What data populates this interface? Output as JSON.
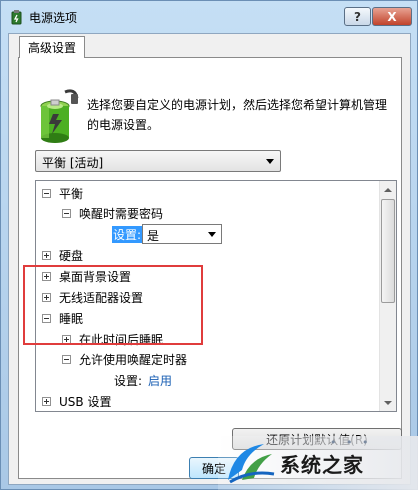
{
  "window": {
    "title": "电源选项",
    "help_label": "?",
    "close_label": "X"
  },
  "tab": {
    "label": "高级设置"
  },
  "description": "选择您要自定义的电源计划，然后选择您希望计算机管理的电源设置。",
  "plan_select": {
    "value": "平衡 [活动]"
  },
  "tree": {
    "balance": "平衡",
    "wake_password": "唤醒时需要密码",
    "setting_label": "设置:",
    "setting_value": "是",
    "hard_disk": "硬盘",
    "desktop_bg": "桌面背景设置",
    "wireless": "无线适配器设置",
    "sleep": "睡眠",
    "sleep_after": "在此时间后睡眠",
    "wake_timers": "允许使用唤醒定时器",
    "wake_setting_label": "设置:",
    "wake_setting_value": "启用",
    "usb": "USB 设置"
  },
  "buttons": {
    "restore": "还原计划默认值(R)",
    "ok": "确定"
  },
  "watermark": {
    "text": "系统之家",
    "sub": "• • •"
  },
  "colors": {
    "highlight_box": "#e03c3c",
    "selection": "#3399ff",
    "link_value": "#1a5fb4"
  }
}
